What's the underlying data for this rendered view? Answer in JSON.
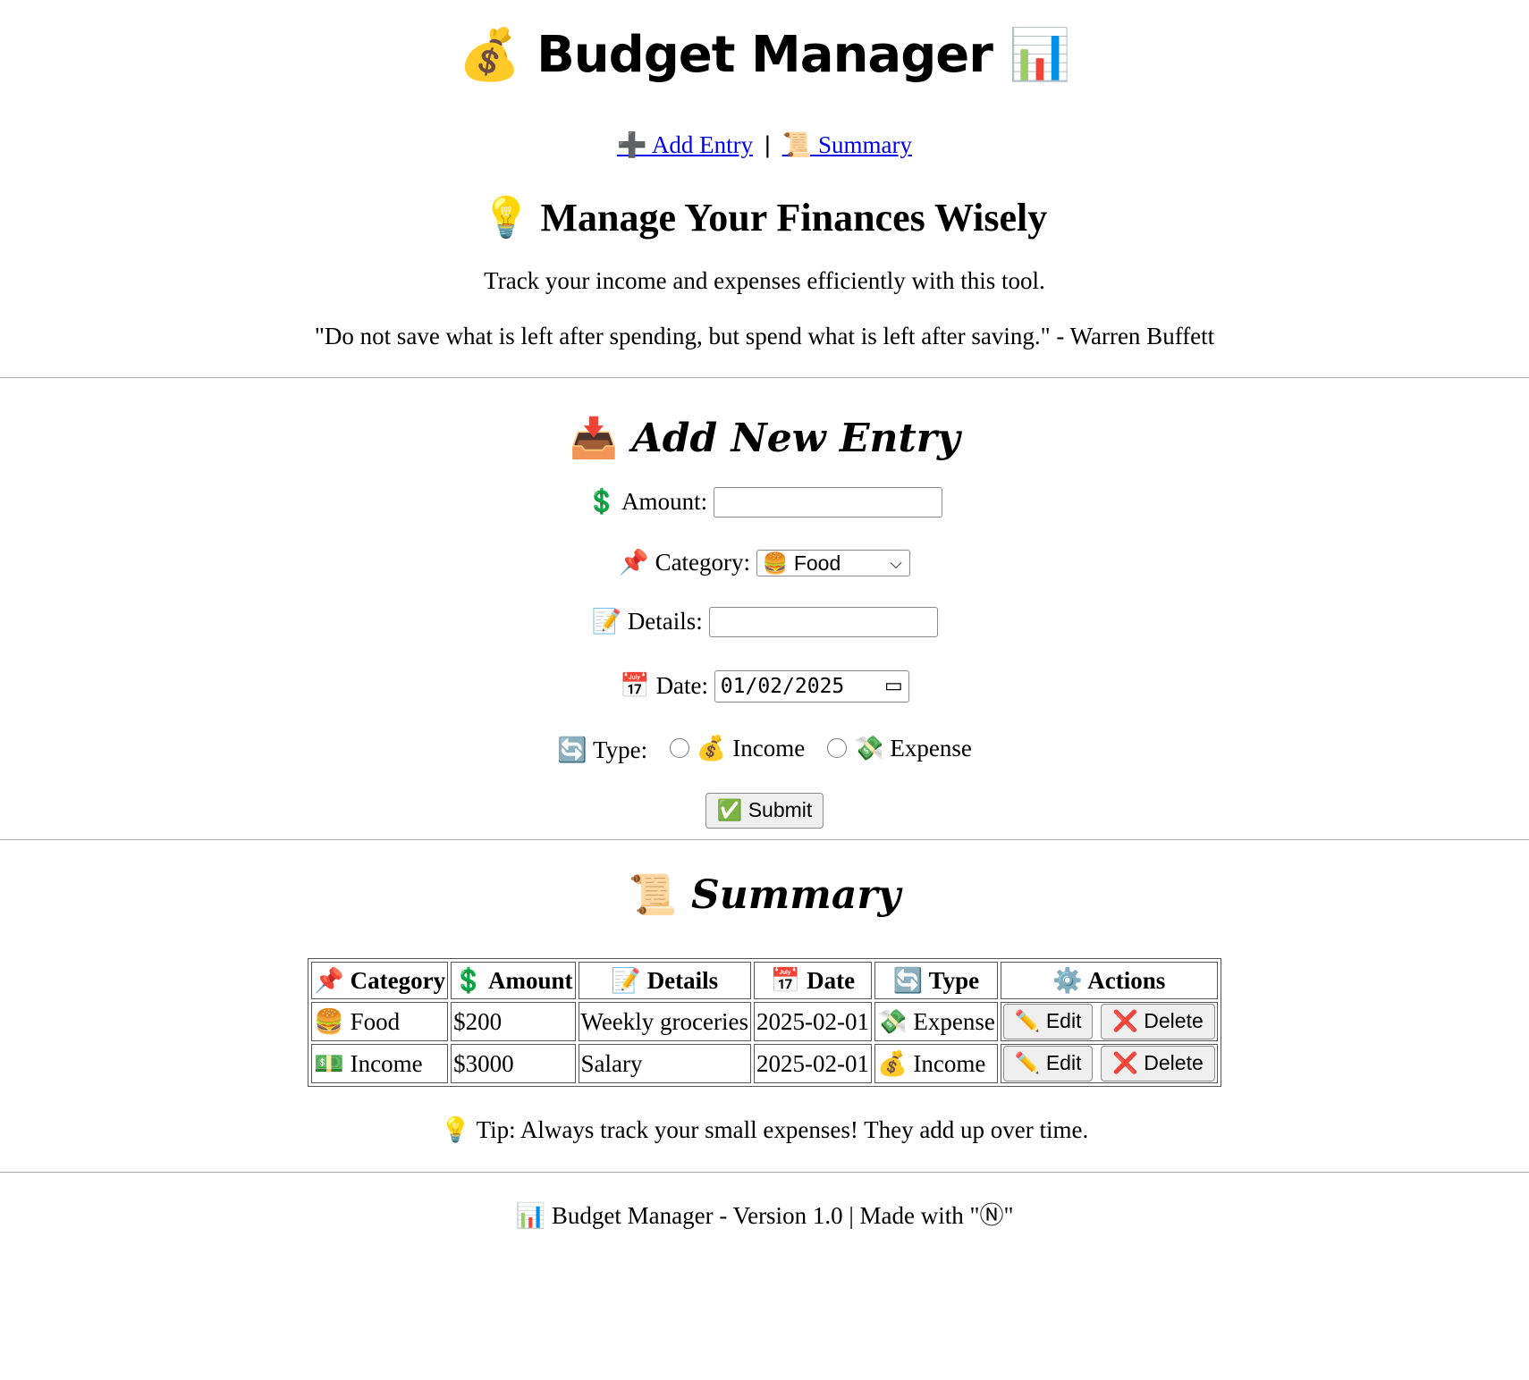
{
  "app": {
    "title": "Budget Manager",
    "title_icon_left": "💰",
    "title_icon_right": "📊"
  },
  "nav": {
    "add_icon": "➕",
    "add_label": " Add Entry",
    "separator": "|",
    "summary_icon": "📜",
    "summary_label": " Summary"
  },
  "intro": {
    "heading_icon": "💡",
    "heading": "Manage Your Finances Wisely",
    "description": "Track your income and expenses efficiently with this tool.",
    "quote": "\"Do not save what is left after spending, but spend what is left after saving.\" - Warren Buffett"
  },
  "form": {
    "heading_icon": "📥",
    "heading": "Add New Entry",
    "amount_icon": "💲",
    "amount_label": "Amount:",
    "amount_value": "",
    "category_icon": "📌",
    "category_label": "Category:",
    "category_selected_icon": "🍔",
    "category_selected": "Food",
    "details_icon": "📝",
    "details_label": "Details:",
    "details_value": "",
    "date_icon": "📅",
    "date_label": "Date:",
    "date_value": "01/02/2025",
    "type_icon": "🔄",
    "type_label": "Type:",
    "type_income_icon": "💰",
    "type_income": "Income",
    "type_expense_icon": "💸",
    "type_expense": "Expense",
    "submit_icon": "✅",
    "submit_label": "Submit"
  },
  "summary": {
    "heading_icon": "📜",
    "heading": "Summary",
    "columns": [
      {
        "icon": "📌",
        "label": "Category"
      },
      {
        "icon": "💲",
        "label": "Amount"
      },
      {
        "icon": "📝",
        "label": "Details"
      },
      {
        "icon": "📅",
        "label": "Date"
      },
      {
        "icon": "🔄",
        "label": "Type"
      },
      {
        "icon": "⚙️",
        "label": "Actions"
      }
    ],
    "rows": [
      {
        "category_icon": "🍔",
        "category": "Food",
        "amount": "$200",
        "details": "Weekly groceries",
        "date": "2025-02-01",
        "type_icon": "💸",
        "type": "Expense",
        "edit_icon": "✏️",
        "edit": "Edit",
        "delete_icon": "❌",
        "delete": "Delete"
      },
      {
        "category_icon": "💵",
        "category": "Income",
        "amount": "$3000",
        "details": "Salary",
        "date": "2025-02-01",
        "type_icon": "💰",
        "type": "Income",
        "edit_icon": "✏️",
        "edit": "Edit",
        "delete_icon": "❌",
        "delete": "Delete"
      }
    ],
    "tip_icon": "💡",
    "tip": "Tip: Always track your small expenses! They add up over time."
  },
  "footer": {
    "icon": "📊",
    "text": "Budget Manager - Version 1.0 | Made with \"Ⓝ\""
  }
}
